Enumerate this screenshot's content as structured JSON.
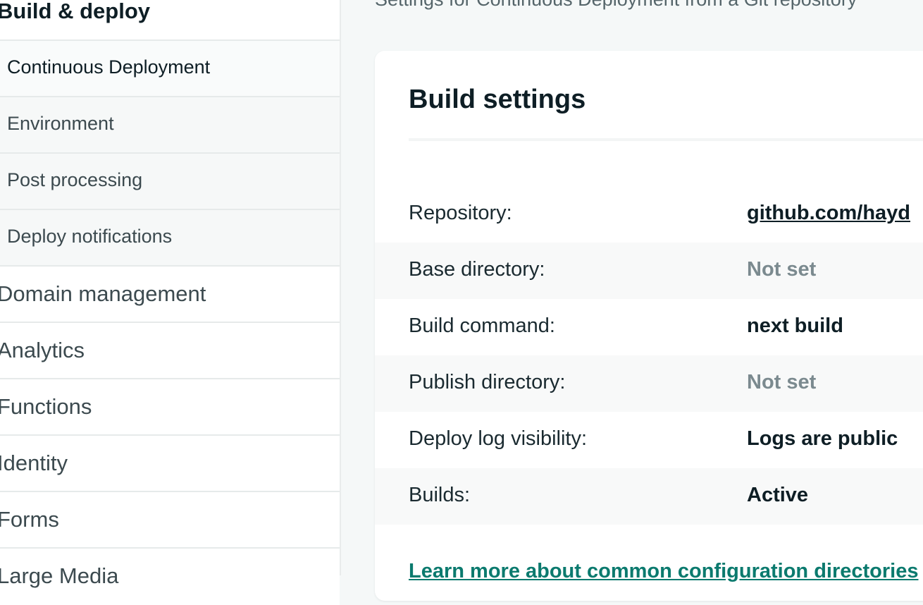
{
  "sidebar": {
    "section_title": "Build & deploy",
    "sub_items": [
      {
        "label": "Continuous Deployment"
      },
      {
        "label": "Environment"
      },
      {
        "label": "Post processing"
      },
      {
        "label": "Deploy notifications"
      }
    ],
    "main_items": [
      {
        "label": "Domain management"
      },
      {
        "label": "Analytics"
      },
      {
        "label": "Functions"
      },
      {
        "label": "Identity"
      },
      {
        "label": "Forms"
      },
      {
        "label": "Large Media"
      }
    ]
  },
  "main": {
    "subtitle": "Settings for Continuous Deployment from a Git repository",
    "card": {
      "title": "Build settings",
      "rows": [
        {
          "label": "Repository:",
          "value": "github.com/hayd"
        },
        {
          "label": "Base directory:",
          "value": "Not set"
        },
        {
          "label": "Build command:",
          "value": "next build"
        },
        {
          "label": "Publish directory:",
          "value": "Not set"
        },
        {
          "label": "Deploy log visibility:",
          "value": "Logs are public"
        },
        {
          "label": "Builds:",
          "value": "Active"
        }
      ],
      "learn_more_link": "Learn more about common configuration directories"
    }
  }
}
